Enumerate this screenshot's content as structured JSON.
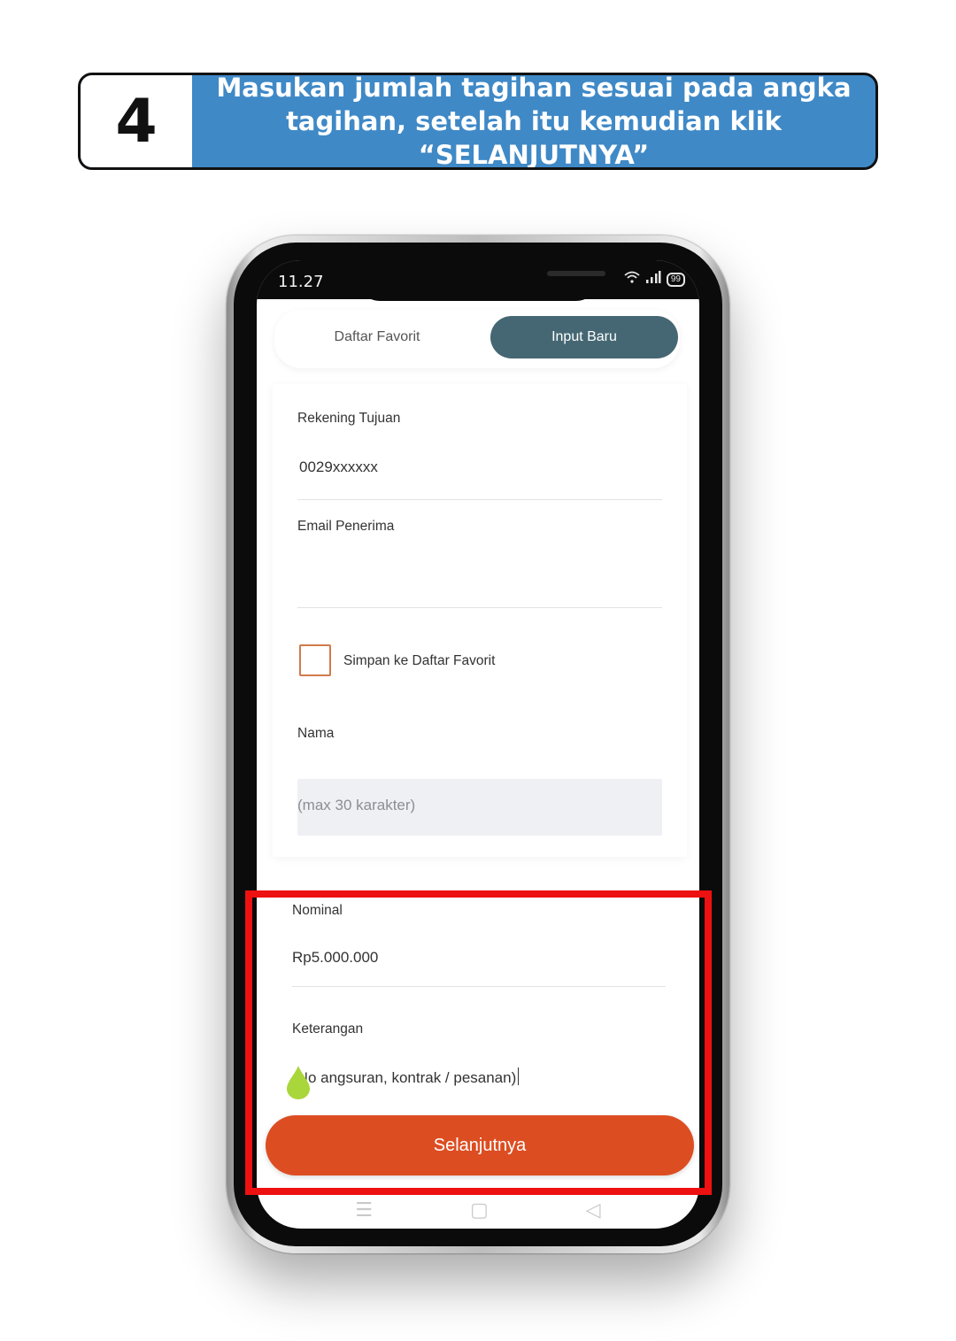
{
  "banner": {
    "step_number": "4",
    "title_line1": "Masukan jumlah tagihan sesuai pada angka",
    "title_line2": "tagihan, setelah itu kemudian klik “SELANJUTNYA”"
  },
  "status_bar": {
    "time": "11.27",
    "battery": "99"
  },
  "tabs": [
    {
      "label": "Daftar Favorit",
      "active": false
    },
    {
      "label": "Input Baru",
      "active": true
    }
  ],
  "form": {
    "rekening_label": "Rekening Tujuan",
    "rekening_value": "0029xxxxxx",
    "email_label": "Email Penerima",
    "email_value": "",
    "save_favorite_label": "Simpan ke Daftar Favorit",
    "save_favorite_checked": false,
    "nama_label": "Nama",
    "nama_placeholder": "(max 30 karakter)",
    "nominal_label": "Nominal",
    "nominal_value": "Rp5.000.000",
    "keterangan_label": "Keterangan",
    "keterangan_placeholder": "(No angsuran, kontrak / pesanan)"
  },
  "actions": {
    "next_label": "Selanjutnya"
  },
  "nav_icons": [
    "menu-icon",
    "home-square-icon",
    "back-triangle-icon"
  ],
  "colors": {
    "banner_blue": "#3f89c7",
    "tab_active": "#456773",
    "next_button": "#dd4d22",
    "highlight": "#ee1111",
    "checkbox_border": "#d07a4a"
  }
}
